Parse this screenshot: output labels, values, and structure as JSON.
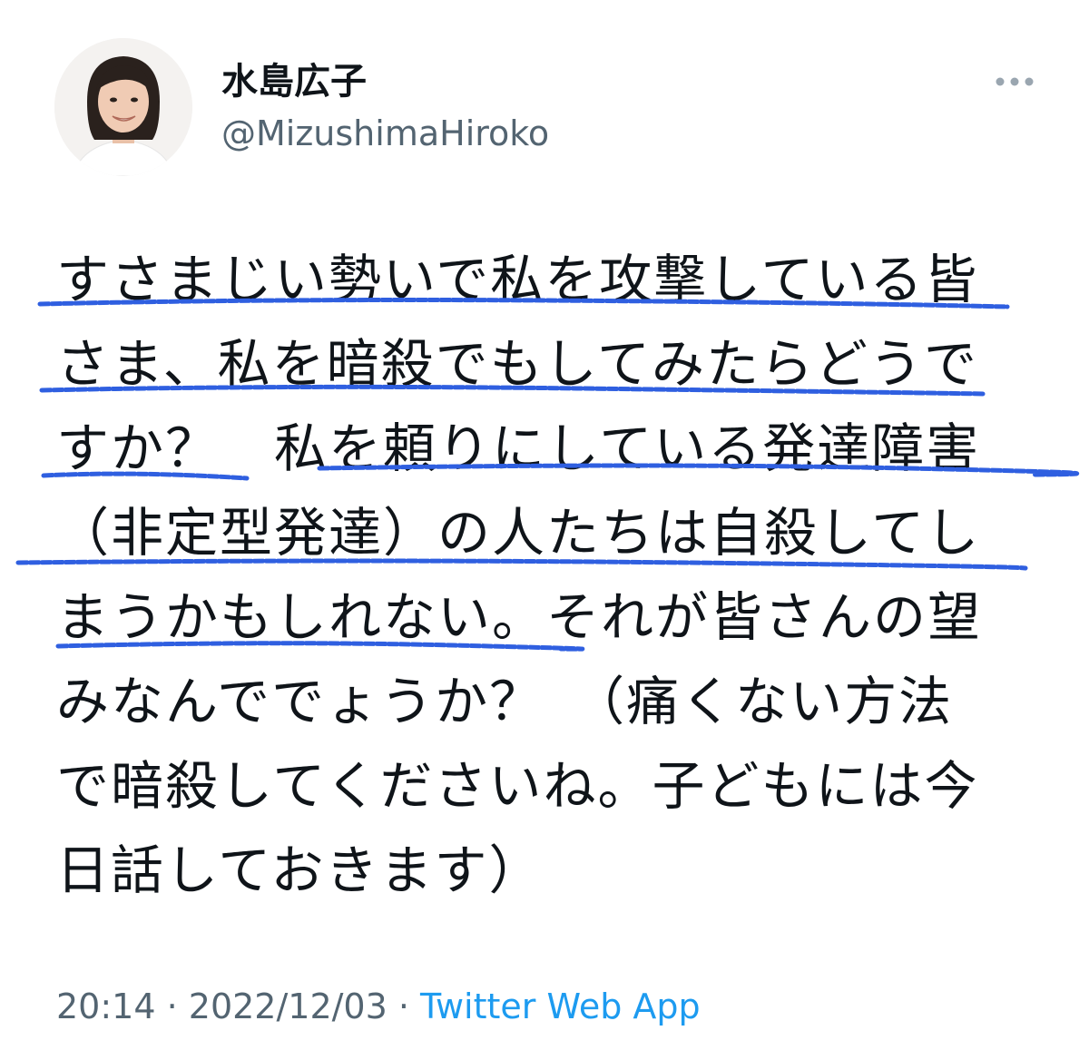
{
  "author": {
    "display_name": "水島広子",
    "handle": "@MizushimaHiroko",
    "avatar_icon": "avatar-photo"
  },
  "more_icon": "more-horizontal-icon",
  "tweet": {
    "lines": [
      "すさまじい勢いで私を攻撃している皆",
      "さま、私を暗殺でもしてみたらどうで",
      "すか？　私を頼りにしている発達障害",
      "（非定型発達）の人たちは自殺してし",
      "まうかもしれない。それが皆さんの望",
      "みなんででょうか？　（痛くない方法",
      "で暗殺してくださいね。子どもには今",
      "日話しておきます）"
    ]
  },
  "meta": {
    "time": "20:14",
    "separator": " · ",
    "date": "2022/12/03",
    "source": "Twitter Web App"
  },
  "colors": {
    "underline": "#2f5fe0",
    "link": "#1d9bf0",
    "secondary_text": "#536471"
  }
}
